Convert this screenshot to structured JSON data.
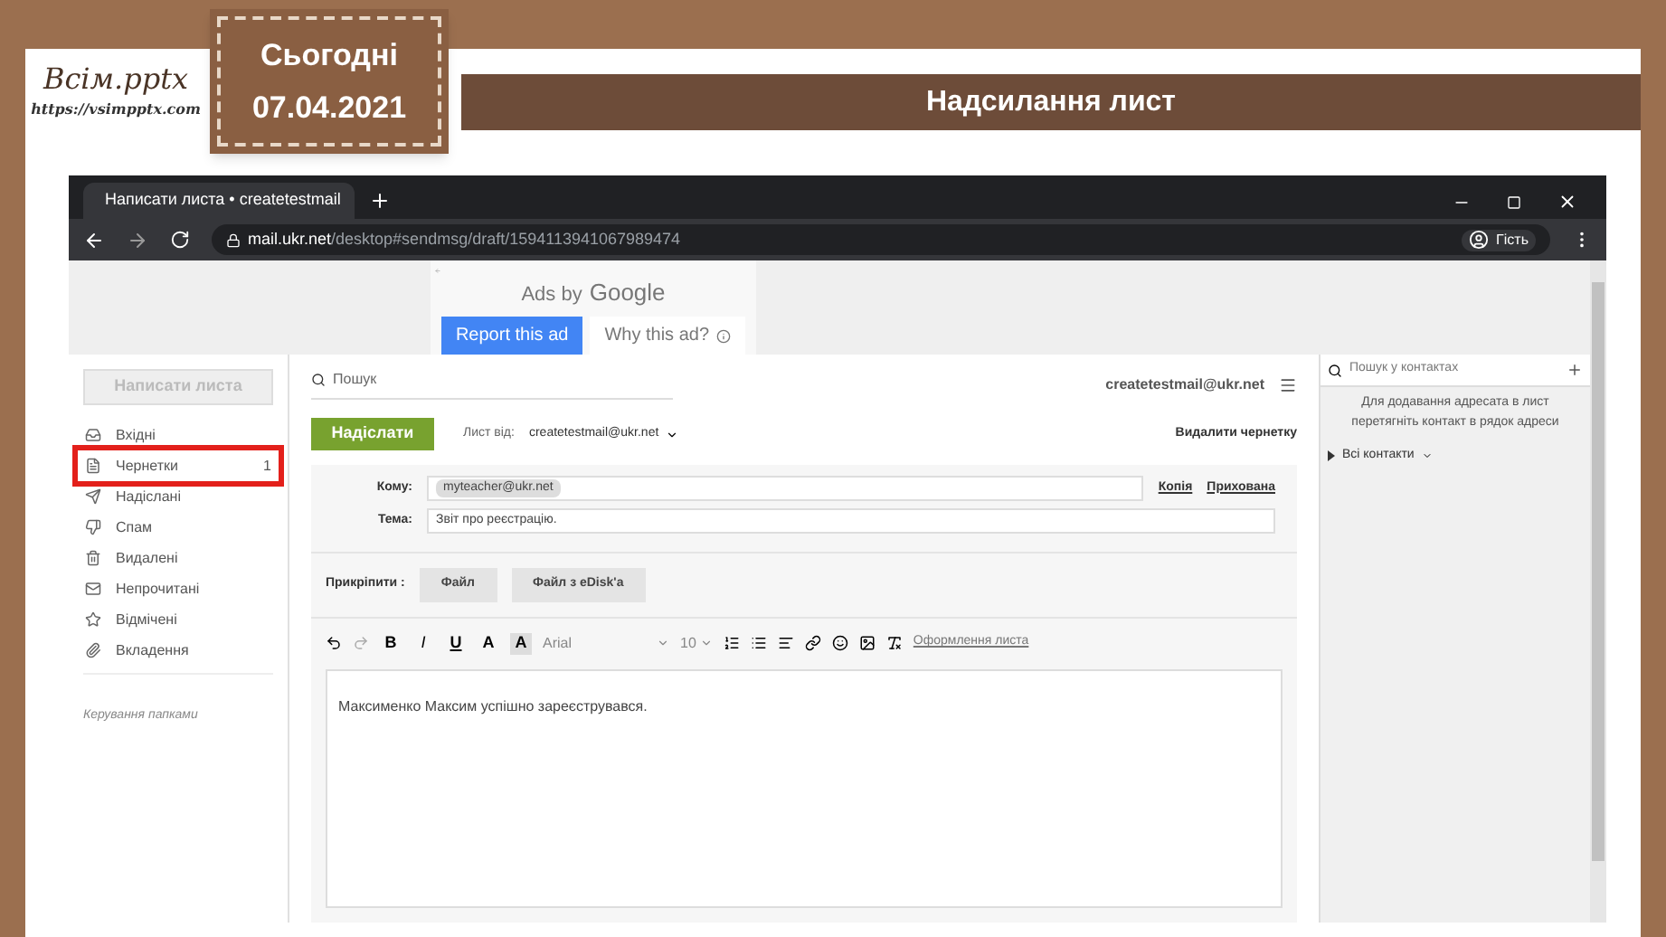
{
  "slide": {
    "logo": {
      "name": "Всім.pptx",
      "url": "https://vsimpptx.com"
    },
    "date_tag": {
      "label": "Сьогодні",
      "date": "07.04.2021"
    },
    "title": "Надсилання лист"
  },
  "browser": {
    "tab": {
      "title": "Написати листа • createtestmail"
    },
    "url": {
      "host": "mail.ukr.net",
      "path": "/desktop#sendmsg/draft/1594113941067989474"
    },
    "profile": "Гість"
  },
  "ad": {
    "label": "Ads by",
    "brand": "Google",
    "report": "Report this ad",
    "why": "Why this ad?"
  },
  "sidebar": {
    "compose": "Написати листа",
    "folders": [
      {
        "label": "Вхідні",
        "highlighted": false
      },
      {
        "label": "Чернетки",
        "count": "1",
        "highlighted": true
      },
      {
        "label": "Надіслані",
        "highlighted": false
      },
      {
        "label": "Спам",
        "highlighted": false
      },
      {
        "label": "Видалені",
        "highlighted": false
      },
      {
        "label": "Непрочитані",
        "highlighted": false
      },
      {
        "label": "Відмічені",
        "highlighted": false
      },
      {
        "label": "Вкладення",
        "highlighted": false
      }
    ],
    "manage": "Керування папками"
  },
  "compose": {
    "search_placeholder": "Пошук",
    "account": "createtestmail@ukr.net",
    "send": "Надіслати",
    "from_label": "Лист від:",
    "from": "createtestmail@ukr.net",
    "delete": "Видалити чернетку",
    "to_label": "Кому:",
    "to": "myteacher@ukr.net",
    "cc": "Копія",
    "bcc": "Прихована",
    "subject_label": "Тема:",
    "subject": "Звіт про реєстрацію.",
    "attach_label": "Прикріпити :",
    "attach_buttons": [
      "Файл",
      "Файл з eDisk'a"
    ],
    "format_buttons": [
      {
        "label": "B",
        "kind": "bold",
        "active": false
      },
      {
        "label": "I",
        "kind": "italic",
        "active": false
      },
      {
        "label": "U",
        "kind": "underline",
        "active": false
      },
      {
        "label": "A",
        "kind": "color",
        "active": false
      },
      {
        "label": "A",
        "kind": "highlight",
        "active": true
      }
    ],
    "font": "Arial",
    "size": "10",
    "design_link": "Оформлення листа",
    "body": "Максименко Максим успішно зареєструвався."
  },
  "contacts": {
    "search_placeholder": "Пошук у контактах",
    "hint": "Для додавання адресата в лист перетягніть контакт в рядок адреси",
    "group": "Всі контакти"
  }
}
